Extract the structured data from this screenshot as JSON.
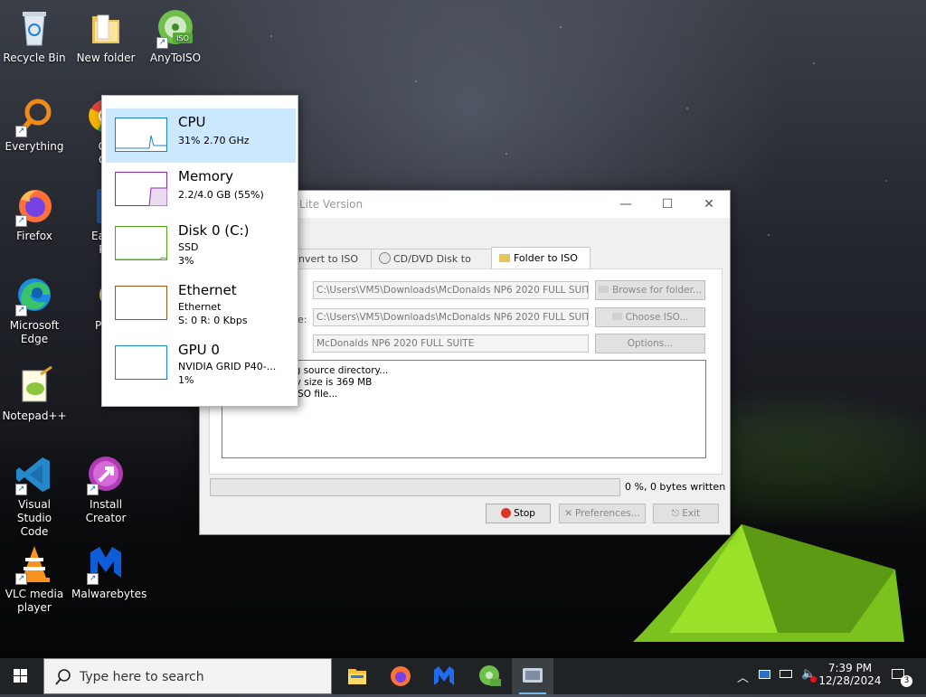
{
  "desktop": {
    "icons": [
      {
        "label": "Recycle Bin",
        "icon": "recycle-bin-icon"
      },
      {
        "label": "New folder",
        "icon": "folder-icon"
      },
      {
        "label": "AnyToISO",
        "icon": "anytoiso-icon"
      },
      {
        "label": "Everything",
        "icon": "everything-search-icon"
      },
      {
        "label_line1": "Go",
        "label_line2": "Ch",
        "icon": "chrome-icon"
      },
      {
        "label": "Firefox",
        "icon": "firefox-icon"
      },
      {
        "label_line1": "Easel",
        "label_line2": "PC",
        "icon": "easeus-icon"
      },
      {
        "label_line1": "Microsoft",
        "label_line2": "Edge",
        "icon": "edge-icon"
      },
      {
        "label": "Pow",
        "icon": "power-icon"
      },
      {
        "label": "Notepad++",
        "icon": "notepadpp-icon"
      },
      {
        "label_line1": "Visual Studio",
        "label_line2": "Code",
        "icon": "vscode-icon"
      },
      {
        "label": "Install Creator",
        "icon": "install-creator-icon"
      },
      {
        "label_line1": "VLC media",
        "label_line2": "player",
        "icon": "vlc-icon"
      },
      {
        "label": "Malwarebytes",
        "icon": "malwarebytes-icon"
      }
    ]
  },
  "perf_flyout": {
    "items": [
      {
        "title": "CPU",
        "lines": [
          "31%  2.70 GHz"
        ],
        "color": "#1785c8",
        "level": 0.31
      },
      {
        "title": "Memory",
        "lines": [
          "2.2/4.0 GB (55%)"
        ],
        "color": "#8b2ab3",
        "level": 0.55
      },
      {
        "title": "Disk 0 (C:)",
        "lines": [
          "SSD",
          "3%"
        ],
        "color": "#4da618",
        "level": 0.03
      },
      {
        "title": "Ethernet",
        "lines": [
          "Ethernet",
          "S: 0  R: 0 Kbps"
        ],
        "color": "#a7561b",
        "level": 0.0
      },
      {
        "title": "GPU 0",
        "lines": [
          "NVIDIA GRID P40-...",
          "1%"
        ],
        "color": "#1785c8",
        "level": 0.01
      }
    ]
  },
  "anytoiso": {
    "title": "Lite Version",
    "tabs": [
      "nvert to ISO",
      "CD/DVD Disk to ISO",
      "Folder to ISO"
    ],
    "active_tab": 2,
    "source_path": "C:\\Users\\VM5\\Downloads\\McDonalds NP6 2020 FULL SUITE",
    "iso_label": "e:",
    "iso_path": "C:\\Users\\VM5\\Downloads\\McDonalds NP6 2020 FULL SUITE.iso",
    "volume_label": "McDonalds NP6 2020 FULL SUITE",
    "browse_button": "Browse for folder...",
    "choose_button": "Choose ISO...",
    "options_button": "Options...",
    "log_lines": [
      "ing source directory...",
      "ory size is 369 MB",
      "g ISO file..."
    ],
    "progress": 0,
    "progress_text": "0 %, 0 bytes written",
    "stop_button": "Stop",
    "preferences_button": "Preferences...",
    "exit_button": "Exit",
    "minimize_glyph": "—",
    "maximize_glyph": "☐",
    "close_glyph": "✕"
  },
  "taskbar": {
    "search_placeholder": "Type here to search",
    "time": "7:39 PM",
    "date": "12/28/2024",
    "notification_count": "3",
    "apps": [
      "file-explorer-icon",
      "firefox-icon",
      "malwarebytes-icon",
      "anytoiso-icon",
      "install-creator-icon"
    ],
    "active_app": "install-creator-icon"
  }
}
